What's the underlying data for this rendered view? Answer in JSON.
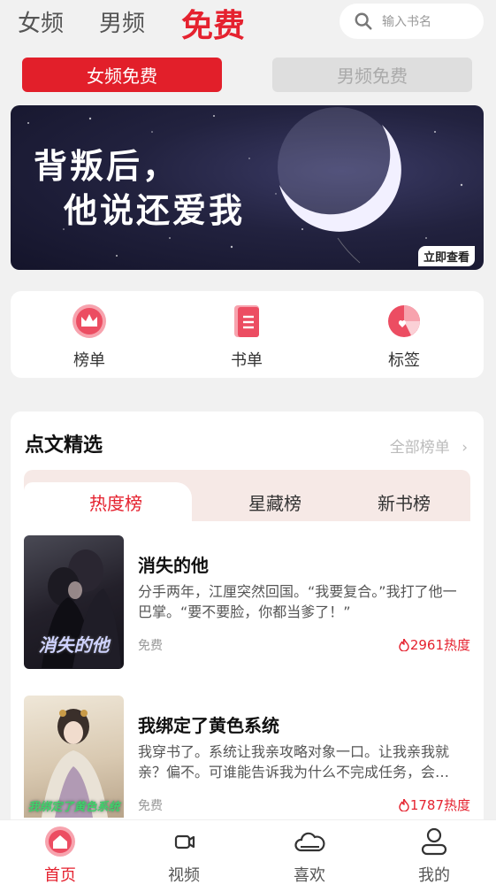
{
  "top_nav": {
    "tabs": [
      "女频",
      "男频"
    ],
    "active_tab": "免费",
    "search_placeholder": "输入书名"
  },
  "sub_tabs": {
    "active": "女频免费",
    "inactive": "男频免费"
  },
  "banner": {
    "line1": "背叛后，",
    "line2": "他说还爱我",
    "cta": "立即查看"
  },
  "quick_entries": [
    {
      "label": "榜单",
      "icon": "crown-icon"
    },
    {
      "label": "书单",
      "icon": "book-list-icon"
    },
    {
      "label": "标签",
      "icon": "tag-pie-icon"
    }
  ],
  "section": {
    "title": "点文精选",
    "more": "全部榜单",
    "rank_tabs": [
      "热度榜",
      "星藏榜",
      "新书榜"
    ],
    "active_rank_tab": "热度榜",
    "books": [
      {
        "cover_text": "消失的他",
        "title": "消失的他",
        "desc": "分手两年，江厘突然回国。“我要复合。”我打了他一巴掌。“要不要脸，你都当爹了！”",
        "tag": "免费",
        "hot": "2961热度"
      },
      {
        "cover_text": "我绑定了黄色系统",
        "title": "我绑定了黄色系统",
        "desc": "我穿书了。系统让我亲攻略对象一口。让我亲我就亲？偏不。可谁能告诉我为什么不完成任务，会…",
        "tag": "免费",
        "hot": "1787热度"
      }
    ]
  },
  "bottom_nav": [
    {
      "label": "首页",
      "icon": "home-icon",
      "active": true
    },
    {
      "label": "视频",
      "icon": "video-icon",
      "active": false
    },
    {
      "label": "喜欢",
      "icon": "cloud-heart-icon",
      "active": false
    },
    {
      "label": "我的",
      "icon": "profile-icon",
      "active": false
    }
  ],
  "colors": {
    "accent": "#e5222f",
    "background": "#f1f1f1"
  }
}
